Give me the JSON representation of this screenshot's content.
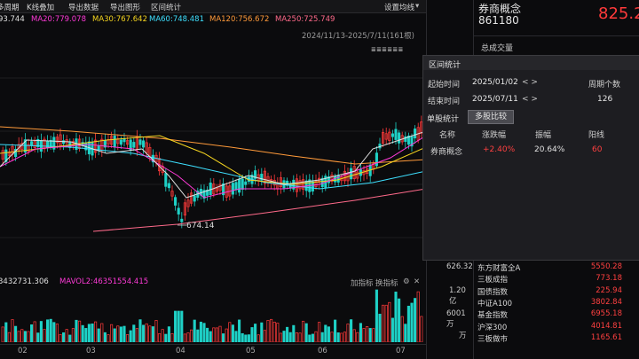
{
  "toolbar": {
    "items": [
      "多周期",
      "K线叠加",
      "导出数据",
      "导出图形",
      "区间统计"
    ],
    "settings_label": "设置均线",
    "kline_icons": "≣ ≣ ≣ ≣ ≣ ≣"
  },
  "ma": {
    "ma10": "93.744",
    "ma20": "MA20:779.078",
    "ma30": "MA30:767.642",
    "ma60": "MA60:748.481",
    "ma120": "MA120:756.672",
    "ma250": "MA250:725.749"
  },
  "date_range": "2024/11/13-2025/7/11(161根)",
  "low_label": "674.14",
  "vol_header": {
    "vol1": "3432731.306",
    "vol2": "MAVOL2:46351554.415",
    "btn_add": "加指标",
    "btn_switch": "换指标"
  },
  "xaxis": [
    "02",
    "03",
    "04",
    "05",
    "06",
    "07"
  ],
  "right_axis": {
    "low_price": "626.32",
    "vol_max": "1.20亿",
    "vol_mid": "6001万",
    "vol_unit": "万"
  },
  "stock": {
    "name": "券商概念",
    "code": "861180",
    "price": "825.2",
    "total_volume_label": "总成交量"
  },
  "interval_stats": {
    "title": "区间统计",
    "start_label": "起始时间",
    "start_value": "2025/01/02",
    "end_label": "结束时间",
    "end_value": "2025/07/11",
    "period_label": "周期个数",
    "period_value": "126",
    "tab_single": "单股统计",
    "tab_multi": "多股比较",
    "col_name": "名称",
    "col_change": "涨跌幅",
    "col_amplitude": "振幅",
    "col_yang": "阳线",
    "row_name": "券商概念",
    "row_change": "+2.40%",
    "row_amplitude": "20.64%",
    "row_yang": "60"
  },
  "indices": [
    {
      "name": "东方财富全A",
      "value": "5550.28"
    },
    {
      "name": "三板成指",
      "value": "773.18"
    },
    {
      "name": "国债指数",
      "value": "225.94"
    },
    {
      "name": "中证A100",
      "value": "3802.84"
    },
    {
      "name": "基金指数",
      "value": "6955.18"
    },
    {
      "name": "沪深300",
      "value": "4014.81"
    },
    {
      "name": "三板做市",
      "value": "1165.61"
    }
  ],
  "colors": {
    "up": "#ff3a3a",
    "down": "#1fd1c6",
    "accent": "#ff4040"
  }
}
